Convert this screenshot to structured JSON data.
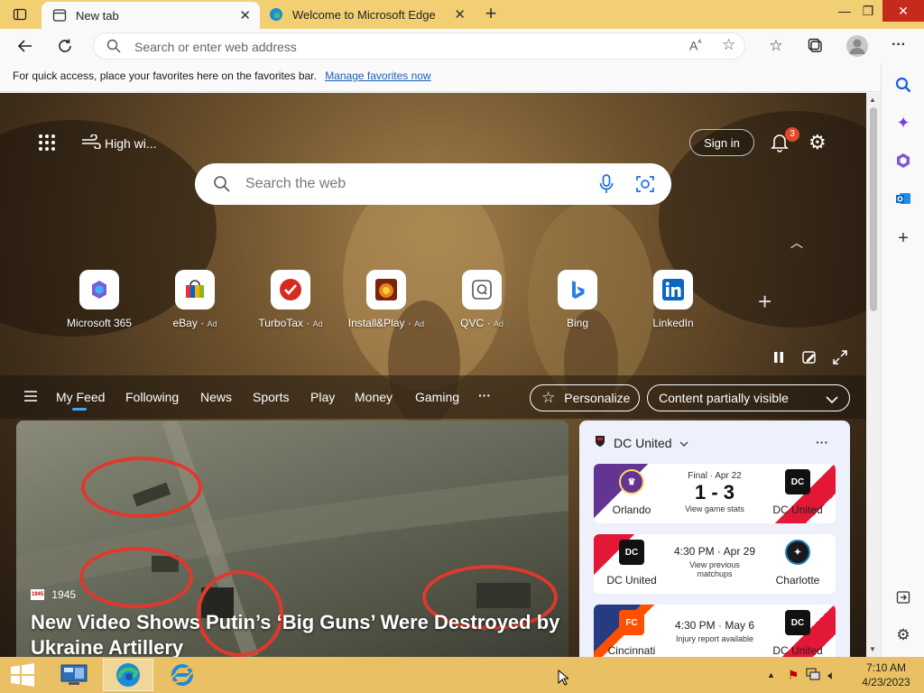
{
  "tabs": [
    {
      "title": "New tab",
      "close": "✕"
    },
    {
      "title": "Welcome to Microsoft Edge",
      "close": "✕"
    }
  ],
  "new_tab_glyph": "+",
  "window_controls": {
    "minimize": "—",
    "maximize": "❐",
    "close": "✕"
  },
  "address_bar": {
    "placeholder": "Search or enter web address"
  },
  "favorites_bar": {
    "message": "For quick access, place your favorites here on the favorites bar.",
    "link": "Manage favorites now"
  },
  "newtab": {
    "weather": "High wi...",
    "sign_in": "Sign in",
    "notification_count": "3",
    "search_placeholder": "Search the web",
    "add_shortcut": "+",
    "shortcuts": [
      {
        "label": "Microsoft 365",
        "ad": "",
        "icon": "microsoft-365-icon",
        "color": "#7b5bd6"
      },
      {
        "label": "eBay",
        "ad": "Ad",
        "icon": "ebay-icon",
        "color": "#e53238"
      },
      {
        "label": "TurboTax",
        "ad": "Ad",
        "icon": "turbotax-icon",
        "color": "#d52b1e"
      },
      {
        "label": "Install&Play",
        "ad": "Ad",
        "icon": "install-play-icon",
        "color": "#c3451b"
      },
      {
        "label": "QVC",
        "ad": "Ad",
        "icon": "qvc-icon",
        "color": "#555555"
      },
      {
        "label": "Bing",
        "ad": "",
        "icon": "bing-icon",
        "color": "#2f7de1"
      },
      {
        "label": "LinkedIn",
        "ad": "",
        "icon": "linkedin-icon",
        "color": "#0a66c2"
      }
    ],
    "feed_tabs": [
      "My Feed",
      "Following",
      "News",
      "Sports",
      "Play",
      "Money",
      "Gaming"
    ],
    "feed_more": "···",
    "personalize": "Personalize",
    "content_visibility": "Content partially visible"
  },
  "hero": {
    "source": "1945",
    "source_badge": "1945",
    "title": "New Video Shows Putin’s ‘Big Guns’ Were Destroyed by Ukraine Artillery"
  },
  "sports": {
    "team": "DC United",
    "more": "···",
    "games": [
      {
        "home": "Orlando",
        "away": "DC United",
        "line1": "Final · Apr 22",
        "line2": "1 - 3",
        "line3": "View game stats"
      },
      {
        "home": "DC United",
        "away": "Charlotte",
        "line1": "4:30 PM · Apr 29",
        "line2": "",
        "line3": "View previous matchups"
      },
      {
        "home": "Cincinnati",
        "away": "DC United",
        "line1": "4:30 PM · May 6",
        "line2": "",
        "line3": "Injury report available"
      }
    ]
  },
  "taskbar": {
    "time": "7:10 AM",
    "date": "4/23/2023"
  },
  "colors": {
    "tabbar": "#f3cf74",
    "taskbar": "#e9c063",
    "accent": "#1a5fb4"
  }
}
